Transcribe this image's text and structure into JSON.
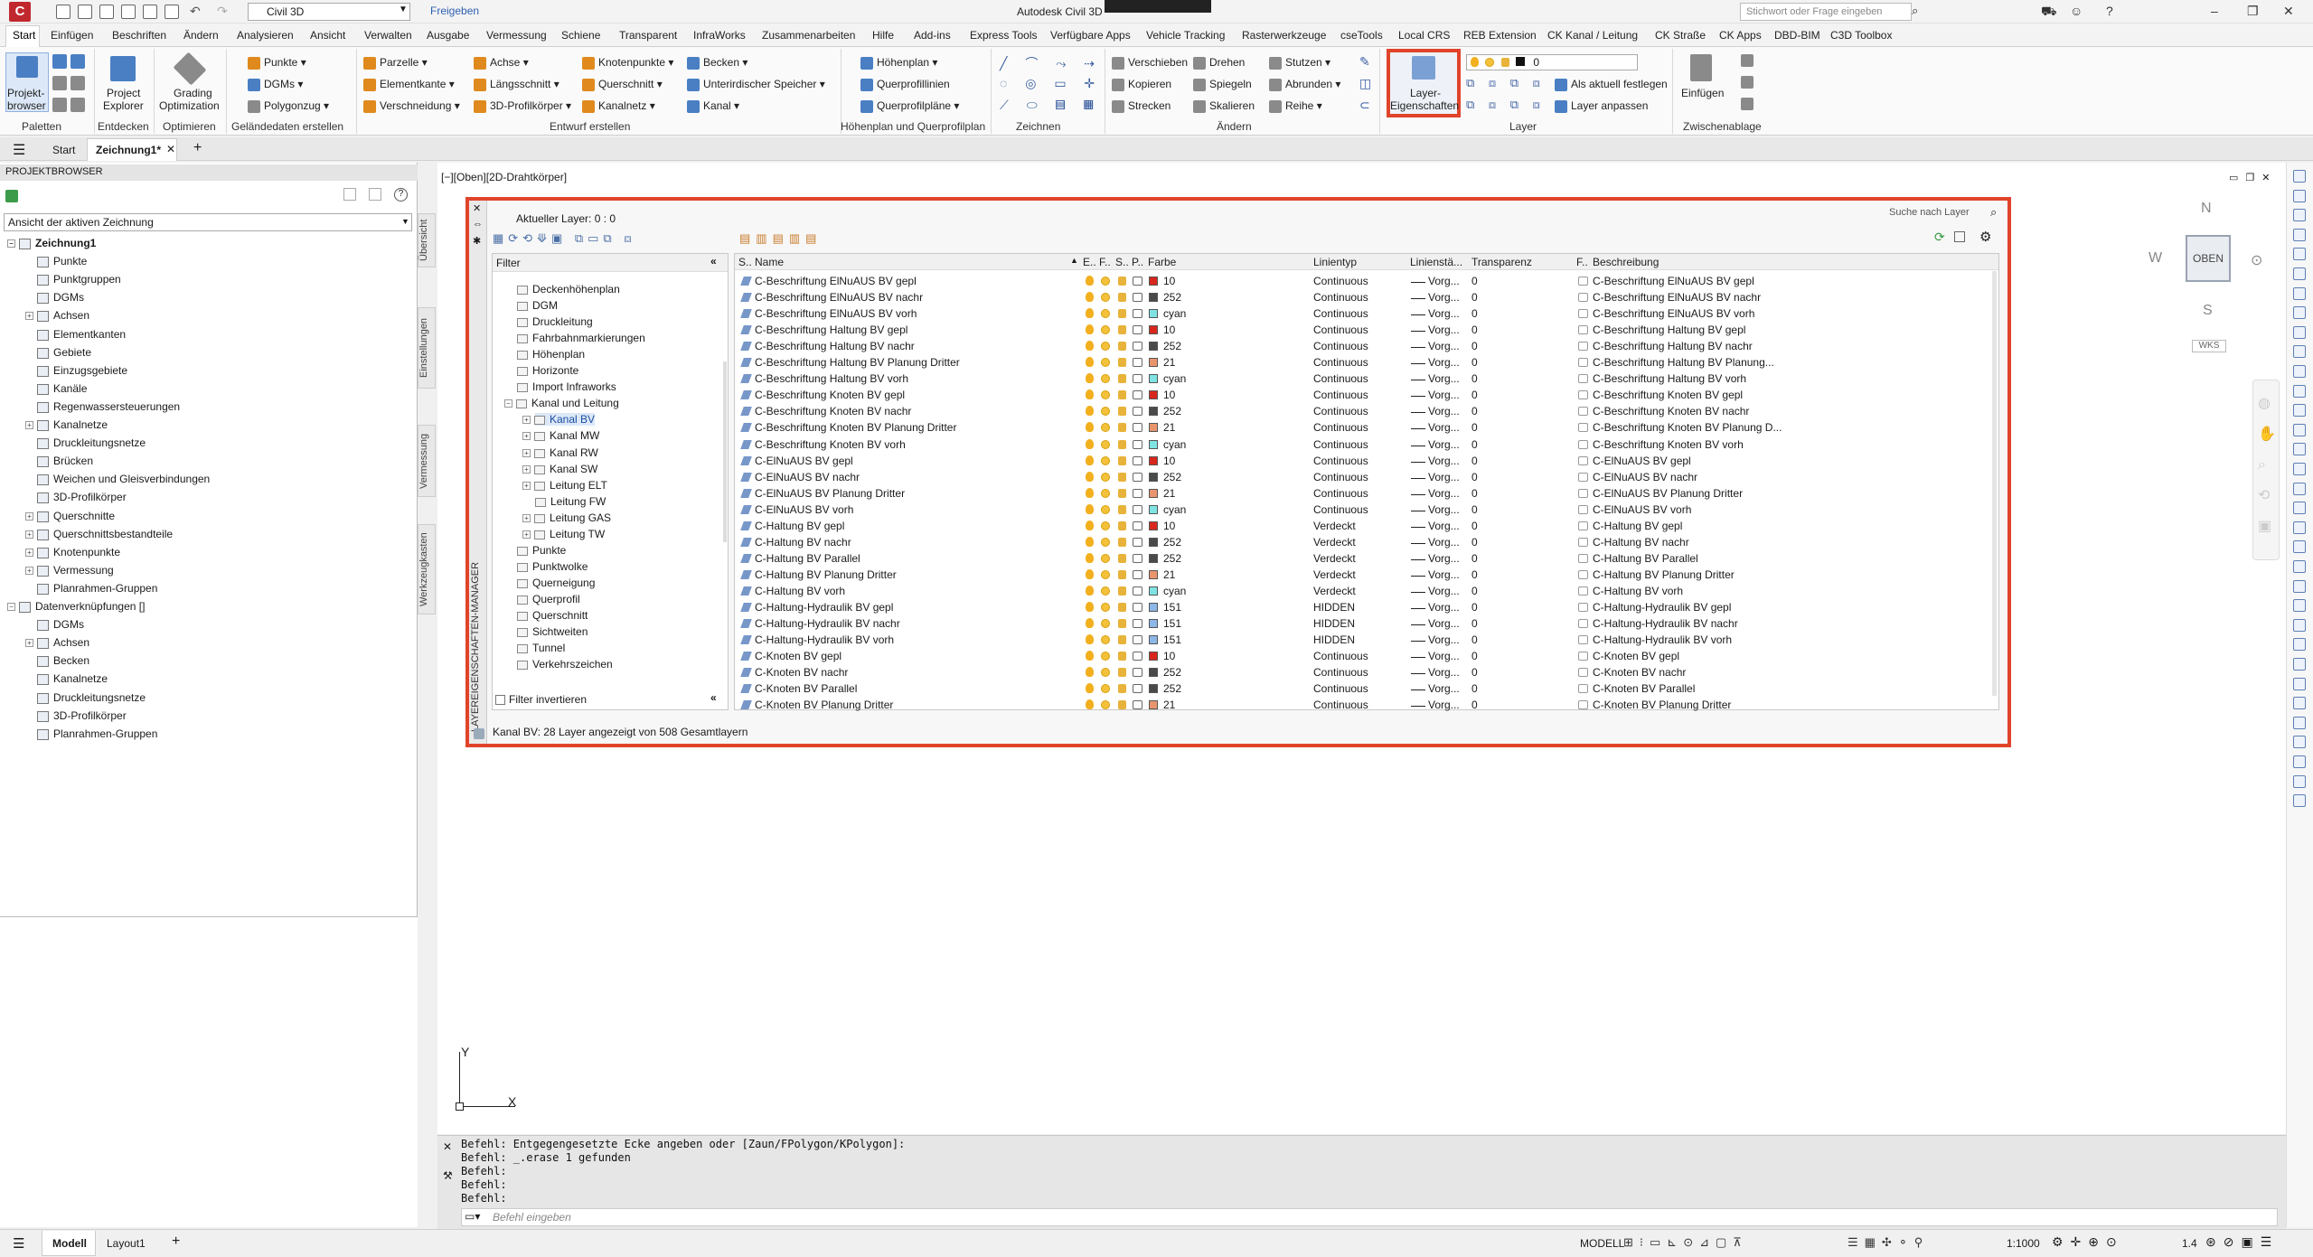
{
  "titlebar": {
    "workspace": "Civil 3D",
    "share": "Freigeben",
    "app_title": "Autodesk Civil 3D",
    "search_placeholder": "Stichwort oder Frage eingeben"
  },
  "menu_tabs": [
    "Start",
    "Einfügen",
    "Beschriften",
    "Ändern",
    "Analysieren",
    "Ansicht",
    "Verwalten",
    "Ausgabe",
    "Vermessung",
    "Schiene",
    "Transparent",
    "InfraWorks",
    "Zusammenarbeiten",
    "Hilfe",
    "Add-ins",
    "Express Tools",
    "Verfügbare Apps",
    "Vehicle Tracking",
    "Rasterwerkzeuge",
    "cseTools",
    "Local CRS",
    "REB Extension",
    "CK Kanal / Leitung",
    "CK Straße",
    "CK Apps",
    "DBD-BIM",
    "C3D Toolbox"
  ],
  "ribbon": {
    "paletten": {
      "btn1": "Projekt-",
      "btn1b": "browser",
      "group": "Paletten"
    },
    "entdecken": {
      "btn": "Project",
      "btnb": "Explorer",
      "group": "Entdecken"
    },
    "optimieren": {
      "btn": "Grading",
      "btnb": "Optimization",
      "group": "Optimieren"
    },
    "gelaende": {
      "items": [
        "Punkte",
        "DGMs",
        "Polygonzug"
      ],
      "group": "Geländedaten erstellen"
    },
    "entwurf": {
      "col1": [
        "Parzelle",
        "Elementkante",
        "Verschneidung"
      ],
      "col2": [
        "Achse",
        "Längsschnitt",
        "3D-Profilkörper"
      ],
      "col3": [
        "Knotenpunkte",
        "Querschnitt",
        "Kanalnetz"
      ],
      "col4": [
        "Becken",
        "Unterirdischer Speicher",
        "Kanal"
      ],
      "group": "Entwurf erstellen"
    },
    "hoehenplan": {
      "items": [
        "Höhenplan",
        "Querprofillinien",
        "Querprofilpläne"
      ],
      "group": "Höhenplan und Querprofilplan"
    },
    "zeichnen": {
      "group": "Zeichnen"
    },
    "aendern": {
      "col1": [
        "Verschieben",
        "Kopieren",
        "Strecken"
      ],
      "col2": [
        "Drehen",
        "Spiegeln",
        "Skalieren"
      ],
      "col3": [
        "Stutzen",
        "Abrunden",
        "Reihe"
      ],
      "group": "Ändern"
    },
    "layer": {
      "btn": "Layer-",
      "btnb": "Eigenschaften",
      "current": "0",
      "as_current": "Als aktuell festlegen",
      "match": "Layer anpassen",
      "group": "Layer"
    },
    "clipboard": {
      "btn": "Einfügen",
      "group": "Zwischenablage"
    }
  },
  "doc_tabs": {
    "start": "Start",
    "active": "Zeichnung1*"
  },
  "project_browser": {
    "title": "PROJEKTBROWSER",
    "view_select": "Ansicht der aktiven Zeichnung",
    "root": "Zeichnung1",
    "items": [
      "Punkte",
      "Punktgruppen",
      "DGMs",
      "Achsen",
      "Elementkanten",
      "Gebiete",
      "Einzugsgebiete",
      "Kanäle",
      "Regenwassersteuerungen",
      "Kanalnetze",
      "Druckleitungsnetze",
      "Brücken",
      "Weichen und Gleisverbindungen",
      "3D-Profilkörper",
      "Querschnitte",
      "Querschnittsbestandteile",
      "Knotenpunkte",
      "Vermessung",
      "Planrahmen-Gruppen"
    ],
    "data_links": "Datenverknüpfungen []",
    "data_items": [
      "DGMs",
      "Achsen",
      "Becken",
      "Kanalnetze",
      "Druckleitungsnetze",
      "3D-Profilkörper",
      "Planrahmen-Gruppen"
    ],
    "side_tabs": [
      "Übersicht",
      "Einstellungen",
      "Vermessung",
      "Werkzeugkasten"
    ]
  },
  "viewport": {
    "label": "[−][Oben][2D-Drahtkörper]"
  },
  "layer_manager": {
    "side_title": "LAYEREIGENSCHAFTEN-MANAGER",
    "current_layer": "Aktueller Layer: 0 : 0",
    "search": "Suche nach Layer",
    "filter_title": "Filter",
    "filter_items": [
      "Deckenhöhenplan",
      "DGM",
      "Druckleitung",
      "Fahrbahnmarkierungen",
      "Höhenplan",
      "Horizonte",
      "Import Infraworks",
      "Kanal und Leitung",
      "Kanal BV",
      "Kanal MW",
      "Kanal RW",
      "Kanal SW",
      "Leitung ELT",
      "Leitung FW",
      "Leitung GAS",
      "Leitung TW",
      "Punkte",
      "Punktwolke",
      "Querneigung",
      "Querprofil",
      "Querschnitt",
      "Sichtweiten",
      "Tunnel",
      "Verkehrszeichen"
    ],
    "invert_filter": "Filter invertieren",
    "status": "Kanal BV: 28 Layer angezeigt von 508 Gesamtlayern",
    "columns": {
      "s": "S..",
      "name": "Name",
      "e": "E..",
      "f": "F..",
      "sp": "S..",
      "p": "P..",
      "color": "Farbe",
      "linetype": "Linientyp",
      "lineweight": "Linienstä...",
      "transparency": "Transparenz",
      "vp": "F..",
      "desc": "Beschreibung"
    },
    "colors": {
      "10": "#d8261d",
      "252": "#4a4a4a",
      "cyan": "#7fe3e3",
      "21": "#e8956e",
      "151": "#8db7e6"
    },
    "rows": [
      {
        "name": "C-Beschriftung ElNuAUS BV gepl",
        "color": "10",
        "lt": "Continuous",
        "lw": "Vorg...",
        "tr": "0",
        "desc": "C-Beschriftung ElNuAUS BV gepl"
      },
      {
        "name": "C-Beschriftung ElNuAUS BV nachr",
        "color": "252",
        "lt": "Continuous",
        "lw": "Vorg...",
        "tr": "0",
        "desc": "C-Beschriftung ElNuAUS BV nachr"
      },
      {
        "name": "C-Beschriftung ElNuAUS BV vorh",
        "color": "cyan",
        "lt": "Continuous",
        "lw": "Vorg...",
        "tr": "0",
        "desc": "C-Beschriftung ElNuAUS BV vorh"
      },
      {
        "name": "C-Beschriftung Haltung BV gepl",
        "color": "10",
        "lt": "Continuous",
        "lw": "Vorg...",
        "tr": "0",
        "desc": "C-Beschriftung Haltung BV gepl"
      },
      {
        "name": "C-Beschriftung Haltung BV nachr",
        "color": "252",
        "lt": "Continuous",
        "lw": "Vorg...",
        "tr": "0",
        "desc": "C-Beschriftung Haltung BV nachr"
      },
      {
        "name": "C-Beschriftung Haltung BV Planung Dritter",
        "color": "21",
        "lt": "Continuous",
        "lw": "Vorg...",
        "tr": "0",
        "desc": "C-Beschriftung Haltung BV Planung..."
      },
      {
        "name": "C-Beschriftung Haltung BV vorh",
        "color": "cyan",
        "lt": "Continuous",
        "lw": "Vorg...",
        "tr": "0",
        "desc": "C-Beschriftung Haltung BV vorh"
      },
      {
        "name": "C-Beschriftung Knoten BV gepl",
        "color": "10",
        "lt": "Continuous",
        "lw": "Vorg...",
        "tr": "0",
        "desc": "C-Beschriftung Knoten BV gepl"
      },
      {
        "name": "C-Beschriftung Knoten BV nachr",
        "color": "252",
        "lt": "Continuous",
        "lw": "Vorg...",
        "tr": "0",
        "desc": "C-Beschriftung Knoten BV nachr"
      },
      {
        "name": "C-Beschriftung Knoten BV Planung Dritter",
        "color": "21",
        "lt": "Continuous",
        "lw": "Vorg...",
        "tr": "0",
        "desc": "C-Beschriftung Knoten BV Planung D..."
      },
      {
        "name": "C-Beschriftung Knoten BV vorh",
        "color": "cyan",
        "lt": "Continuous",
        "lw": "Vorg...",
        "tr": "0",
        "desc": "C-Beschriftung Knoten BV vorh"
      },
      {
        "name": "C-ElNuAUS BV gepl",
        "color": "10",
        "lt": "Continuous",
        "lw": "Vorg...",
        "tr": "0",
        "desc": "C-ElNuAUS BV gepl"
      },
      {
        "name": "C-ElNuAUS BV nachr",
        "color": "252",
        "lt": "Continuous",
        "lw": "Vorg...",
        "tr": "0",
        "desc": "C-ElNuAUS BV nachr"
      },
      {
        "name": "C-ElNuAUS BV Planung Dritter",
        "color": "21",
        "lt": "Continuous",
        "lw": "Vorg...",
        "tr": "0",
        "desc": "C-ElNuAUS BV Planung Dritter"
      },
      {
        "name": "C-ElNuAUS BV vorh",
        "color": "cyan",
        "lt": "Continuous",
        "lw": "Vorg...",
        "tr": "0",
        "desc": "C-ElNuAUS BV vorh"
      },
      {
        "name": "C-Haltung BV gepl",
        "color": "10",
        "lt": "Verdeckt",
        "lw": "Vorg...",
        "tr": "0",
        "desc": "C-Haltung BV gepl"
      },
      {
        "name": "C-Haltung BV nachr",
        "color": "252",
        "lt": "Verdeckt",
        "lw": "Vorg...",
        "tr": "0",
        "desc": "C-Haltung BV nachr"
      },
      {
        "name": "C-Haltung BV Parallel",
        "color": "252",
        "lt": "Verdeckt",
        "lw": "Vorg...",
        "tr": "0",
        "desc": "C-Haltung BV Parallel"
      },
      {
        "name": "C-Haltung BV Planung Dritter",
        "color": "21",
        "lt": "Verdeckt",
        "lw": "Vorg...",
        "tr": "0",
        "desc": "C-Haltung BV Planung Dritter"
      },
      {
        "name": "C-Haltung BV vorh",
        "color": "cyan",
        "lt": "Verdeckt",
        "lw": "Vorg...",
        "tr": "0",
        "desc": "C-Haltung BV vorh"
      },
      {
        "name": "C-Haltung-Hydraulik BV gepl",
        "color": "151",
        "lt": "HIDDEN",
        "lw": "Vorg...",
        "tr": "0",
        "desc": "C-Haltung-Hydraulik BV gepl"
      },
      {
        "name": "C-Haltung-Hydraulik BV nachr",
        "color": "151",
        "lt": "HIDDEN",
        "lw": "Vorg...",
        "tr": "0",
        "desc": "C-Haltung-Hydraulik BV nachr"
      },
      {
        "name": "C-Haltung-Hydraulik BV vorh",
        "color": "151",
        "lt": "HIDDEN",
        "lw": "Vorg...",
        "tr": "0",
        "desc": "C-Haltung-Hydraulik BV vorh"
      },
      {
        "name": "C-Knoten BV gepl",
        "color": "10",
        "lt": "Continuous",
        "lw": "Vorg...",
        "tr": "0",
        "desc": "C-Knoten BV gepl"
      },
      {
        "name": "C-Knoten BV nachr",
        "color": "252",
        "lt": "Continuous",
        "lw": "Vorg...",
        "tr": "0",
        "desc": "C-Knoten BV nachr"
      },
      {
        "name": "C-Knoten BV Parallel",
        "color": "252",
        "lt": "Continuous",
        "lw": "Vorg...",
        "tr": "0",
        "desc": "C-Knoten BV Parallel"
      },
      {
        "name": "C-Knoten BV Planung Dritter",
        "color": "21",
        "lt": "Continuous",
        "lw": "Vorg...",
        "tr": "0",
        "desc": "C-Knoten BV Planung Dritter"
      }
    ]
  },
  "viewcube": {
    "n": "N",
    "s": "S",
    "w": "W",
    "face": "OBEN",
    "wcs": "WKS"
  },
  "ucs": {
    "x": "X",
    "y": "Y"
  },
  "command": {
    "lines": [
      "Befehl: Entgegengesetzte Ecke angeben oder [Zaun/FPolygon/KPolygon]:",
      "Befehl: _.erase 1 gefunden",
      "Befehl:",
      "Befehl:",
      "Befehl:"
    ],
    "placeholder": "Befehl eingeben"
  },
  "statusbar": {
    "model_tab": "Modell",
    "layout_tab": "Layout1",
    "mode": "MODELL",
    "scale": "1:1000",
    "num": "1.4"
  }
}
